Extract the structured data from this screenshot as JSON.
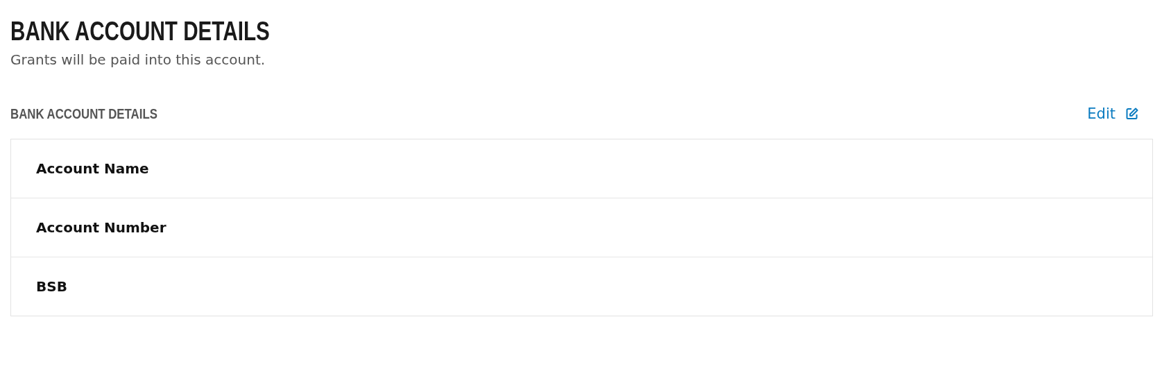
{
  "page": {
    "title": "BANK ACCOUNT DETAILS",
    "subtitle": "Grants will be paid into this account."
  },
  "section": {
    "heading": "BANK ACCOUNT DETAILS",
    "edit_link": "Edit"
  },
  "rows": [
    {
      "label": "Account Name"
    },
    {
      "label": "Account Number"
    },
    {
      "label": "BSB"
    }
  ]
}
